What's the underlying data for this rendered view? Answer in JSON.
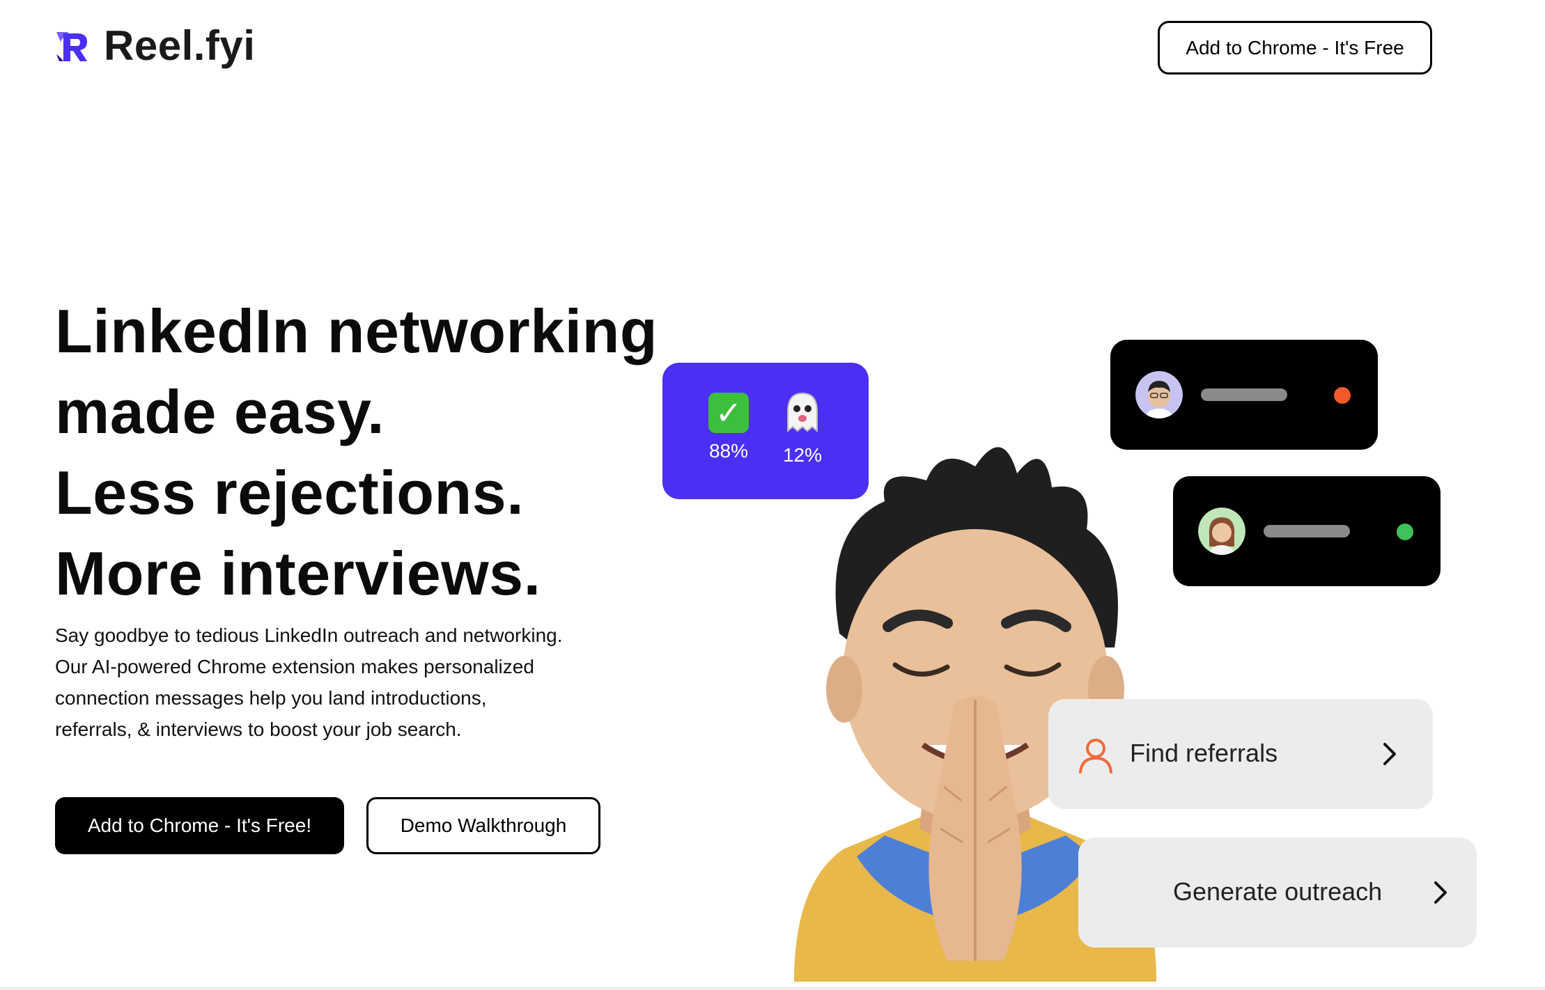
{
  "header": {
    "brand": "Reel.fyi",
    "cta_label": "Add to Chrome - It's Free"
  },
  "hero": {
    "title_lines": [
      "LinkedIn networking",
      "made easy.",
      "Less rejections.",
      "More interviews."
    ],
    "description_lines": [
      "Say goodbye to tedious LinkedIn outreach and networking.",
      "Our AI-powered Chrome extension makes personalized",
      "connection messages help you land introductions,",
      "referrals, & interviews to boost your job search."
    ],
    "primary_button": "Add to Chrome - It's Free!",
    "secondary_button": "Demo Walkthrough"
  },
  "stats_card": {
    "accepted": {
      "icon": "check-mark-icon",
      "value": "88%"
    },
    "ghosted": {
      "icon": "ghost-icon",
      "value": "12%"
    }
  },
  "profiles": [
    {
      "avatar": "avatar-man-icon",
      "status_color": "#ef5a2a"
    },
    {
      "avatar": "avatar-woman-icon",
      "status_color": "#3ec25c"
    }
  ],
  "actions": {
    "find_referrals": "Find referrals",
    "generate_outreach": "Generate outreach"
  },
  "colors": {
    "accent": "#4b2ff2",
    "primary_button": "#000000",
    "pill_background": "#ececec",
    "referral_icon": "#ef6a3a"
  }
}
